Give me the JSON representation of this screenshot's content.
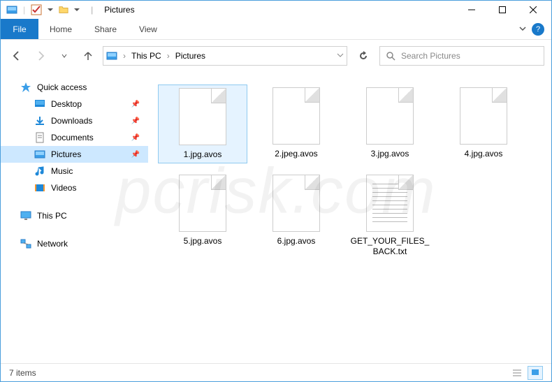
{
  "title": "Pictures",
  "ribbon": {
    "file": "File",
    "tabs": [
      "Home",
      "Share",
      "View"
    ]
  },
  "breadcrumb": [
    "This PC",
    "Pictures"
  ],
  "search": {
    "placeholder": "Search Pictures"
  },
  "sidebar": {
    "quick_access": "Quick access",
    "items": [
      {
        "label": "Desktop",
        "pinned": true
      },
      {
        "label": "Downloads",
        "pinned": true
      },
      {
        "label": "Documents",
        "pinned": true
      },
      {
        "label": "Pictures",
        "pinned": true,
        "selected": true
      },
      {
        "label": "Music",
        "pinned": false
      },
      {
        "label": "Videos",
        "pinned": false
      }
    ],
    "this_pc": "This PC",
    "network": "Network"
  },
  "files": [
    {
      "name": "1.jpg.avos",
      "type": "unknown",
      "selected": true
    },
    {
      "name": "2.jpeg.avos",
      "type": "unknown"
    },
    {
      "name": "3.jpg.avos",
      "type": "unknown"
    },
    {
      "name": "4.jpg.avos",
      "type": "unknown"
    },
    {
      "name": "5.jpg.avos",
      "type": "unknown"
    },
    {
      "name": "6.jpg.avos",
      "type": "unknown"
    },
    {
      "name": "GET_YOUR_FILES_BACK.txt",
      "type": "txt"
    }
  ],
  "status": {
    "count": "7 items"
  },
  "watermark": "pcrisk.com"
}
